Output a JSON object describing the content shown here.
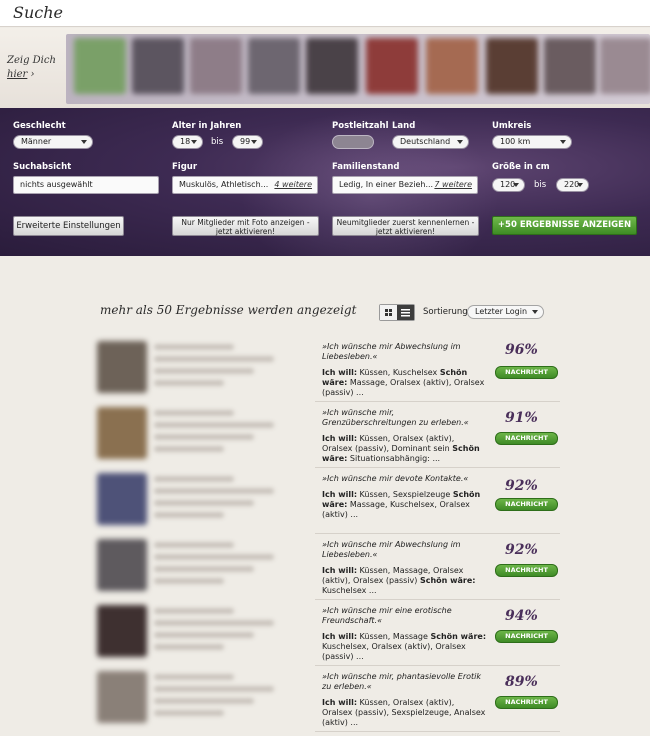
{
  "header": {
    "title": "Suche"
  },
  "strip": {
    "zeig_line1": "Zeig Dich",
    "zeig_line2": "hier",
    "zeig_arrow": "›"
  },
  "search": {
    "geschlecht_label": "Geschlecht",
    "geschlecht_value": "Männer",
    "alter_label": "Alter in Jahren",
    "alter_min": "18",
    "alter_bis": "bis",
    "alter_max": "99",
    "plz_label": "Postleitzahl",
    "land_label": "Land",
    "land_value": "Deutschland",
    "umkreis_label": "Umkreis",
    "umkreis_value": "100 km",
    "suchabsicht_label": "Suchabsicht",
    "suchabsicht_value": "nichts ausgewählt",
    "figur_label": "Figur",
    "figur_value": "Muskulös, Athletisch...",
    "figur_more": "4 weitere",
    "familienstand_label": "Familienstand",
    "familienstand_value": "Ledig, In einer Bezieh...",
    "familienstand_more": "7 weitere",
    "groesse_label": "Größe in cm",
    "groesse_min": "120",
    "groesse_bis": "bis",
    "groesse_max": "220",
    "btn_erweitert": "Erweiterte Einstellungen",
    "btn_foto_line1": "Nur Mitglieder mit Foto anzeigen -",
    "btn_foto_line2": "jetzt aktivieren!",
    "btn_neu_line1": "Neumitglieder zuerst kennenlernen -",
    "btn_neu_line2": "jetzt aktivieren!",
    "btn_show": "+50 ERGEBNISSE ANZEIGEN"
  },
  "results": {
    "heading": "mehr als 50 Ergebnisse werden angezeigt",
    "sort_label": "Sortierung",
    "sort_value": "Letzter Login",
    "message_label": "NACHRICHT",
    "rows": [
      {
        "quote": "»Ich wünsche mir Abwechslung im Liebesleben.«",
        "ich_will": "Ich will:",
        "wants": " Küssen, Kuschelsex ",
        "schoen": "Schön wäre:",
        "nice": " Massage, Oralsex (aktiv), Oralsex (passiv) ...",
        "percent": "96%"
      },
      {
        "quote": "»Ich wünsche mir, Grenzüberschreitungen zu erleben.«",
        "ich_will": "Ich will:",
        "wants": " Küssen, Oralsex (aktiv), Oralsex (passiv), Dominant sein ",
        "schoen": "Schön wäre:",
        "nice": " Situationsabhängig: ...",
        "percent": "91%"
      },
      {
        "quote": "»Ich wünsche mir devote Kontakte.«",
        "ich_will": "Ich will:",
        "wants": " Küssen, Sexspielzeuge ",
        "schoen": "Schön wäre:",
        "nice": " Massage, Kuschelsex, Oralsex (aktiv) ...",
        "percent": "92%"
      },
      {
        "quote": "»Ich wünsche mir Abwechslung im Liebesleben.«",
        "ich_will": "Ich will:",
        "wants": " Küssen, Massage, Oralsex (aktiv), Oralsex (passiv) ",
        "schoen": "Schön wäre:",
        "nice": " Kuschelsex ...",
        "percent": "92%"
      },
      {
        "quote": "»Ich wünsche mir eine erotische Freundschaft.«",
        "ich_will": "Ich will:",
        "wants": " Küssen, Massage ",
        "schoen": "Schön wäre:",
        "nice": " Kuschelsex, Oralsex (aktiv), Oralsex (passiv) ...",
        "percent": "94%"
      },
      {
        "quote": "»Ich wünsche mir, phantasievolle Erotik zu erleben.«",
        "ich_will": "Ich will:",
        "wants": " Küssen, Oralsex (aktiv), Oralsex (passiv), Sexspielzeuge, Analsex (aktiv) ...",
        "schoen": "",
        "nice": "",
        "percent": "89%"
      }
    ]
  },
  "colors": {
    "panel": "#3d2a52",
    "accent_green": "#4e9e30",
    "percent": "#4a2f5a"
  }
}
